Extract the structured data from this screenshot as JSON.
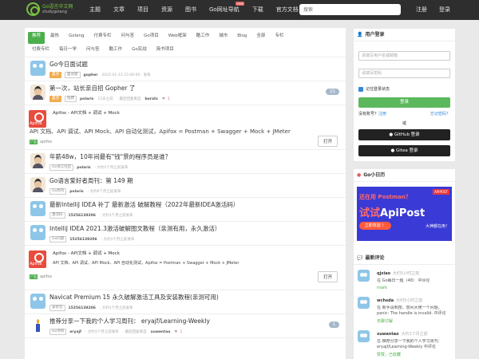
{
  "site": {
    "logo_cn": "Go语言中文网",
    "logo_en": "studygolang"
  },
  "nav": {
    "items": [
      "主题",
      "文章",
      "项目",
      "资源",
      "图书",
      "Go网址导航",
      "下载",
      "官方文档 ▾"
    ],
    "new_badge": "new",
    "search_placeholder": "搜索",
    "register": "注册",
    "login": "登录"
  },
  "tabs": {
    "row1": [
      "推荐",
      "最热",
      "Golang",
      "付费专栏",
      "问与答",
      "Go项目",
      "Web框架",
      "酷工作",
      "城市",
      "Blog",
      "全部",
      "专栏"
    ],
    "row2": [
      "付费专栏",
      "每日一学",
      "问与答",
      "酷工作",
      "Go实战",
      "简书项目"
    ]
  },
  "topics": [
    {
      "title": "Go今日面试题",
      "tag": "置顶",
      "node": "面试题",
      "user": "gopher",
      "time": "2022-01-13 15:40:00 · 发布",
      "last": "",
      "likes": "",
      "count": "",
      "avatar": "gopher",
      "hot": true
    },
    {
      "title": "第一次，站长亲自招 Gopher 了",
      "tag": "置顶",
      "node": "招聘",
      "user": "polaris",
      "time": "15天之前",
      "last": "· 最后回复来自",
      "lastuser": "borats",
      "likes": "1",
      "count": "21",
      "avatar": "person",
      "hot": true
    },
    {
      "title": "年薪48w，10年间最有\"钱\"景的程序员是谁？",
      "tag": "",
      "node": "Go语言社区",
      "user": "polaris",
      "time": "· 大约1个月之前发布",
      "last": "",
      "likes": "",
      "count": "",
      "avatar": "person",
      "hot": false
    },
    {
      "title": "Go语言爱好者周刊：第 149 期",
      "tag": "",
      "node": "Go周刊",
      "user": "polaris",
      "time": "· 大约6个月之前发布",
      "last": "",
      "likes": "",
      "count": "",
      "avatar": "person",
      "hot": false
    },
    {
      "title": "最新IntelliJ IDEA 补丁 最新激活 破解教程（2022年最新IDEA激活码）",
      "tag": "",
      "node": "激活码",
      "user": "15256139206",
      "time": "· 大约1个月之前发布",
      "last": "",
      "likes": "",
      "count": "",
      "avatar": "gopher",
      "hot": false
    },
    {
      "title": "IntelliJ IDEA 2021.3激活破解图文教程（亲测有用，永久激活）",
      "tag": "",
      "node": "Go问题",
      "user": "15256139206",
      "time": "· 大约1个月之前发布",
      "last": "",
      "likes": "",
      "count": "",
      "avatar": "gopher",
      "hot": false
    },
    {
      "title": "Navicat Premium 15 永久破解激活工具及安装教程(亲测可用)",
      "tag": "",
      "node": "安装包",
      "user": "15256139206",
      "time": "· 大约1个月之前发布",
      "last": "",
      "likes": "",
      "count": "",
      "avatar": "gopher",
      "hot": false
    },
    {
      "title": "推荐分享一下我的个人学习周刊： eryajf/Learning-Weekly",
      "tag": "",
      "node": "Go项目",
      "user": "eryajf",
      "time": "· 大约1个月之前发布",
      "last": "· 最后回复来自",
      "lastuser": "xuwentao",
      "likes": "1",
      "count": "1",
      "avatar": "candle",
      "hot": false
    }
  ],
  "ads": [
    {
      "logo": "Apifox",
      "title": "Apifox - API文档 + 调试 + Mock",
      "desc": "API 文档、API 调试、API Mock、API 自动化测试，Apifox = Postman + Swagger + Mock + JMeter",
      "mark": "广告",
      "brand": "apifox",
      "button": "打开"
    },
    {
      "logo": "Apifox",
      "title": "Apifox - API文档 + 调试 + Mock",
      "desc": "API 文档、API 调试、API Mock、API 自动化测试，Apifox = Postman + Swagger + Mock + JMeter",
      "mark": "广告",
      "brand": "apifox",
      "button": "打开"
    }
  ],
  "login": {
    "header": "用户登录",
    "user_placeholder": "请填写用户名或邮箱",
    "pass_placeholder": "请填写密码",
    "remember": "记住登录状态",
    "submit": "登录",
    "no_account": "没有账号？",
    "register": "注册",
    "forgot": "忘记密码？",
    "or": "或",
    "github": "GitHub 登录",
    "gitea": "Gitea 登录"
  },
  "friend": {
    "header": "Go小日历",
    "b1": "还在用 Postman？",
    "b2_cn": "试试",
    "b2_en": "ApiPost",
    "btn": "立即体验 〉",
    "right": "大神都在用！",
    "logo": "APIPOST"
  },
  "comments": {
    "header": "最新评论",
    "items": [
      {
        "user": "qjxiao",
        "time": "大约5小时之前",
        "text": "在 Go每日一题（48） 中评论",
        "reply": "mark"
      },
      {
        "user": "wchsda",
        "time": "大约5小时之前",
        "text": "在 新手请到按，想问大佬一个问题，panic: The handle is invalid. 中评论",
        "reply": "无聊讨解"
      },
      {
        "user": "xuwentao",
        "time": "大约1个月之前",
        "text": "在 推荐分享一下我的个人学习周刊： eryajf/Learning-Weekly 中评论",
        "reply": "赞赞，已收藏"
      }
    ]
  },
  "colors": {
    "accent": "#4cae4c",
    "topbar": "#2e2e2e",
    "link": "#3388dd"
  }
}
